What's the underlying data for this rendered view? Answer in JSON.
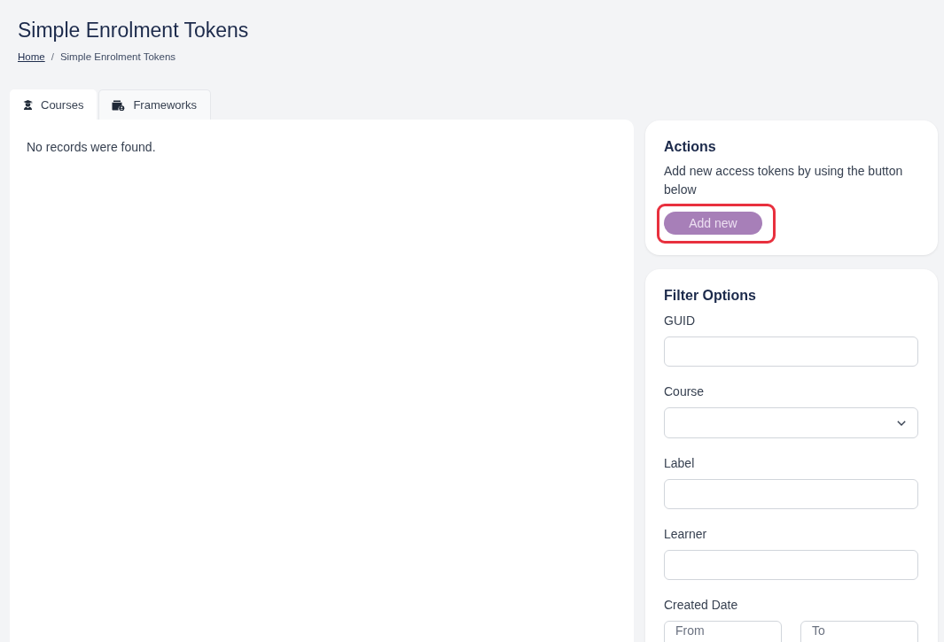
{
  "page": {
    "title": "Simple Enrolment Tokens"
  },
  "breadcrumb": {
    "separator": "/",
    "items": [
      {
        "label": "Home",
        "kind": "link"
      },
      {
        "label": "Simple Enrolment Tokens",
        "kind": "current"
      }
    ]
  },
  "tabs": [
    {
      "label": "Courses",
      "selected": true
    },
    {
      "label": "Frameworks",
      "selected": false
    }
  ],
  "results": {
    "message": "No records were found."
  },
  "actions": {
    "title": "Actions",
    "description": "Add new access tokens by using the button below",
    "button": {
      "label": "Add new",
      "disabled": true,
      "highlighted": true
    }
  },
  "filters": {
    "title": "Filter Options",
    "fields": [
      {
        "label": "GUID",
        "kind": "text"
      },
      {
        "label": "Course",
        "kind": "select"
      },
      {
        "label": "Label",
        "kind": "text"
      },
      {
        "label": "Learner",
        "kind": "text"
      },
      {
        "label": "Created Date",
        "kind": "date-range",
        "inputs": [
          {
            "placeholder": "From"
          },
          {
            "placeholder": "To"
          }
        ]
      }
    ]
  }
}
